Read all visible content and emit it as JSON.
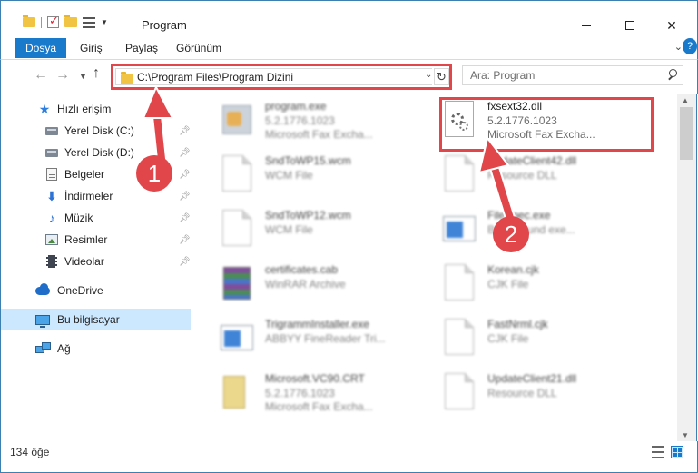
{
  "window": {
    "title": "Program",
    "controls": {
      "minimize": "",
      "maximize": "",
      "close": "✕"
    }
  },
  "ribbon": {
    "tabs": [
      "Dosya",
      "Giriş",
      "Paylaş",
      "Görünüm"
    ],
    "help": "?"
  },
  "navigation": {
    "address": "C:\\Program Files\\Program Dizini",
    "search_placeholder": "Ara: Program"
  },
  "sidebar": {
    "items": [
      {
        "label": "Hızlı erişim",
        "icon": "star-icon",
        "pinned": false
      },
      {
        "label": "Yerel Disk (C:)",
        "icon": "drive-icon",
        "pinned": true
      },
      {
        "label": "Yerel Disk (D:)",
        "icon": "drive-icon",
        "pinned": true
      },
      {
        "label": "Belgeler",
        "icon": "documents-icon",
        "pinned": true
      },
      {
        "label": "İndirmeler",
        "icon": "download-icon",
        "pinned": true
      },
      {
        "label": "Müzik",
        "icon": "music-icon",
        "pinned": true
      },
      {
        "label": "Resimler",
        "icon": "pictures-icon",
        "pinned": true
      },
      {
        "label": "Videolar",
        "icon": "videos-icon",
        "pinned": true
      },
      {
        "label": "OneDrive",
        "icon": "onedrive-icon",
        "pinned": false
      },
      {
        "label": "Bu bilgisayar",
        "icon": "this-pc-icon",
        "pinned": false,
        "selected": true
      },
      {
        "label": "Ağ",
        "icon": "network-icon",
        "pinned": false
      }
    ]
  },
  "files": [
    {
      "name": "program.exe",
      "meta1": "5.2.1776.1023",
      "meta2": "Microsoft Fax Excha...",
      "icon": "exe-icon",
      "blurred": true
    },
    {
      "name": "fxsext32.dll",
      "meta1": "5.2.1776.1023",
      "meta2": "Microsoft Fax Excha...",
      "icon": "dll-gear-icon",
      "blurred": false
    },
    {
      "name": "SndToWP15.wcm",
      "meta1": "WCM File",
      "meta2": "",
      "icon": "blank-page-icon",
      "blurred": true
    },
    {
      "name": "UpdateClient42.dll",
      "meta1": "Resource DLL",
      "meta2": "",
      "icon": "blank-page-icon",
      "blurred": true
    },
    {
      "name": "SndToWP12.wcm",
      "meta1": "WCM File",
      "meta2": "",
      "icon": "blank-page-icon",
      "blurred": true
    },
    {
      "name": "FileSpec.exe",
      "meta1": "Background exe...",
      "meta2": "",
      "icon": "window-app-icon",
      "blurred": true
    },
    {
      "name": "certificates.cab",
      "meta1": "WinRAR Archive",
      "meta2": "",
      "icon": "winrar-icon",
      "blurred": true
    },
    {
      "name": "Korean.cjk",
      "meta1": "CJK File",
      "meta2": "",
      "icon": "blank-page-icon",
      "blurred": true
    },
    {
      "name": "TrigrammInstaller.exe",
      "meta1": "ABBYY FineReader Tri...",
      "meta2": "",
      "icon": "window-app-icon",
      "blurred": true
    },
    {
      "name": "FastNrml.cjk",
      "meta1": "CJK File",
      "meta2": "",
      "icon": "blank-page-icon",
      "blurred": true
    },
    {
      "name": "Microsoft.VC90.CRT",
      "meta1": "5.2.1776.1023",
      "meta2": "Microsoft Fax Excha...",
      "icon": "vc-icon",
      "blurred": true
    },
    {
      "name": "UpdateClient21.dll",
      "meta1": "Resource DLL",
      "meta2": "",
      "icon": "blank-page-icon",
      "blurred": true
    }
  ],
  "status": {
    "count": "134 öğe"
  },
  "annotations": {
    "step1": "1",
    "step2": "2",
    "color": "#e0464a"
  },
  "colors": {
    "accent": "#1979ca",
    "selection": "#cce8ff",
    "highlight": "#e0464a"
  }
}
